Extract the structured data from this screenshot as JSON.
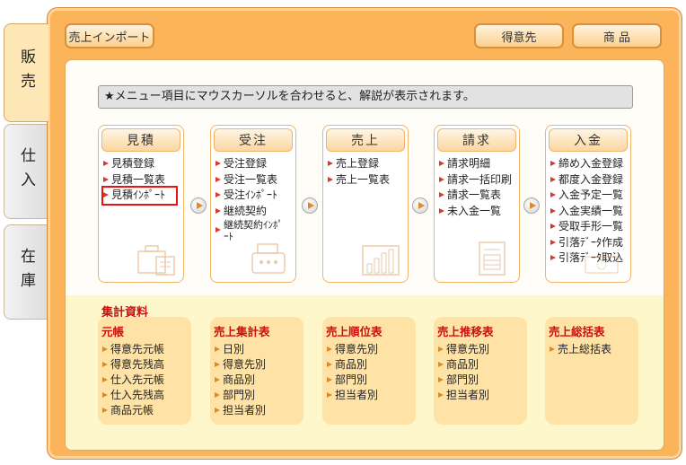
{
  "side_tabs": [
    {
      "label": "販売",
      "active": true
    },
    {
      "label": "仕入",
      "active": false
    },
    {
      "label": "在庫",
      "active": false
    }
  ],
  "toolbar": {
    "import_label": "売上インポート",
    "customer_label": "得意先",
    "product_label": "商 品"
  },
  "hint_text": "★メニュー項目にマウスカーソルを合わせると、解説が表示されます。",
  "modules": [
    {
      "title": "見積",
      "items": [
        "見積登録",
        "見積一覧表",
        "見積ｲﾝﾎﾟｰﾄ"
      ],
      "selected_item": "見積ｲﾝﾎﾟｰﾄ"
    },
    {
      "title": "受注",
      "items": [
        "受注登録",
        "受注一覧表",
        "受注ｲﾝﾎﾟｰﾄ",
        "継続契約",
        "継続契約ｲﾝﾎﾟｰﾄ"
      ]
    },
    {
      "title": "売上",
      "items": [
        "売上登録",
        "売上一覧表"
      ]
    },
    {
      "title": "請求",
      "items": [
        "請求明細",
        "請求一括印刷",
        "請求一覧表",
        "未入金一覧"
      ]
    },
    {
      "title": "入金",
      "items": [
        "締め入金登録",
        "都度入金登録",
        "入金予定一覧",
        "入金実績一覧",
        "受取手形一覧",
        "引落ﾃﾞｰﾀ作成",
        "引落ﾃﾞｰﾀ取込"
      ]
    }
  ],
  "summary": {
    "title": "集計資料",
    "groups": [
      {
        "title": "元帳",
        "items": [
          "得意先元帳",
          "得意先残高",
          "仕入先元帳",
          "仕入先残高",
          "商品元帳"
        ]
      },
      {
        "title": "売上集計表",
        "items": [
          "日別",
          "得意先別",
          "商品別",
          "部門別",
          "担当者別"
        ]
      },
      {
        "title": "売上順位表",
        "items": [
          "得意先別",
          "商品別",
          "部門別",
          "担当者別"
        ]
      },
      {
        "title": "売上推移表",
        "items": [
          "得意先別",
          "商品別",
          "部門別",
          "担当者別"
        ]
      },
      {
        "title": "売上総括表",
        "items": [
          "売上総括表"
        ]
      }
    ]
  },
  "colors": {
    "frame": "#fbb45a",
    "accent_red": "#cc1010",
    "summary_bg": "#fff7cc"
  }
}
